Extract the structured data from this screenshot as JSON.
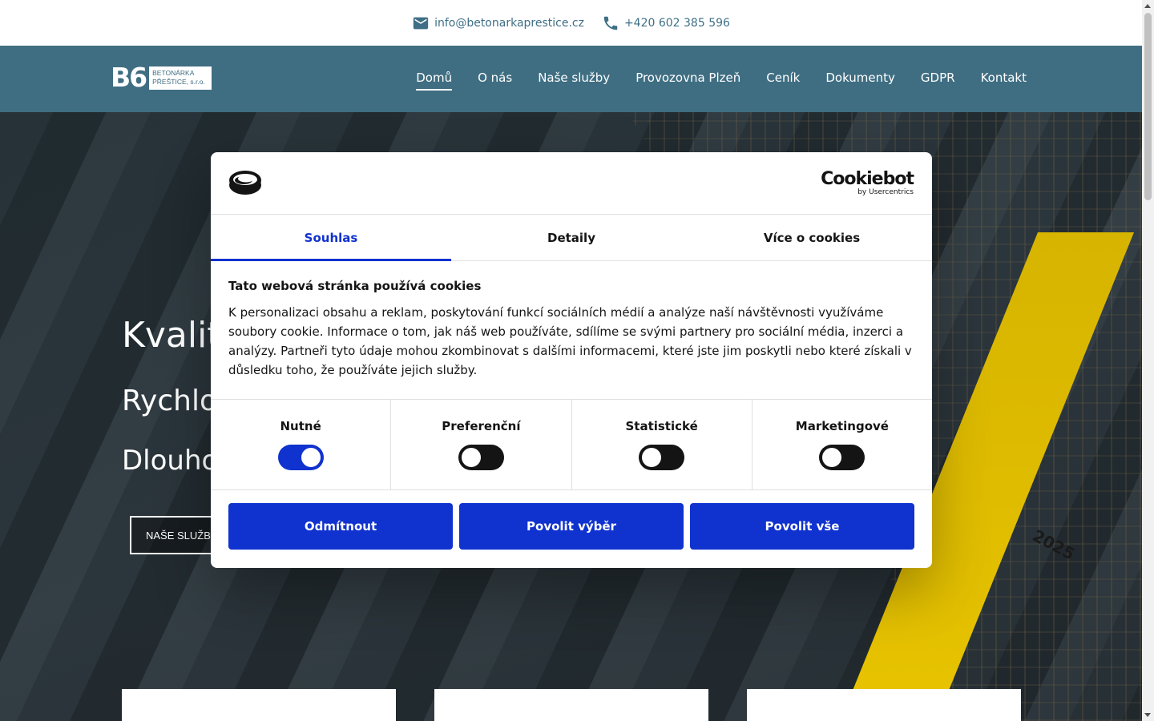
{
  "topbar": {
    "email": "info@betonarkaprestice.cz",
    "phone": "+420 602 385 596",
    "email_icon": "mail-icon",
    "phone_icon": "phone-icon"
  },
  "logo": {
    "mark": "B6",
    "line1": "BETONÁRKA",
    "line2": "PŘEŠTICE, s.r.o."
  },
  "nav": {
    "items": [
      "Domů",
      "O nás",
      "Naše služby",
      "Provozovna Plzeň",
      "Ceník",
      "Dokumenty",
      "GDPR",
      "Kontakt"
    ],
    "active": "Domů"
  },
  "hero": {
    "headline": "Kvalit",
    "line2": "Rychlo",
    "line3": "Dlouhol",
    "cta": "NAŠE SLUŽBY",
    "crane_text": "2025"
  },
  "cookie_dialog": {
    "brand_name": "Cookiebot",
    "brand_sub": "by Usercentrics",
    "tabs": [
      "Souhlas",
      "Detaily",
      "Více o cookies"
    ],
    "active_tab": "Souhlas",
    "title": "Tato webová stránka používá cookies",
    "text": "K personalizaci obsahu a reklam, poskytování funkcí sociálních médií a analýze naší návštěvnosti využíváme soubory cookie. Informace o tom, jak náš web používáte, sdílíme se svými partnery pro sociální média, inzerci a analýzy. Partneři tyto údaje mohou zkombinovat s dalšími informacemi, které jste jim poskytli nebo které získali v důsledku toho, že používáte jejich služby.",
    "toggles": [
      {
        "label": "Nutné",
        "on": true
      },
      {
        "label": "Preferenční",
        "on": false
      },
      {
        "label": "Statistické",
        "on": false
      },
      {
        "label": "Marketingové",
        "on": false
      }
    ],
    "buttons": [
      "Odmítnout",
      "Povolit výběr",
      "Povolit vše"
    ]
  },
  "colors": {
    "nav_bg": "#3f6e82",
    "accent": "#1032cf",
    "contact_text": "#3e6f86"
  }
}
